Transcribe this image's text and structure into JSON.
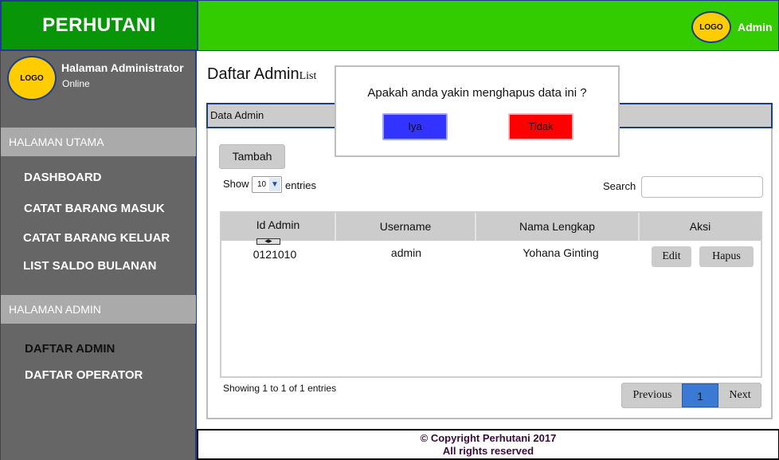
{
  "brand": {
    "title": "PERHUTANI"
  },
  "topbar": {
    "logo_text": "LOGO",
    "user": "Admin"
  },
  "sidebar": {
    "logo_text": "LOGO",
    "profile_name": "Halaman Administrator",
    "profile_status": "Online",
    "sections": [
      {
        "label": "HALAMAN UTAMA",
        "items": [
          "DASHBOARD",
          "CATAT BARANG MASUK",
          "CATAT BARANG KELUAR",
          "LIST SALDO BULANAN"
        ]
      },
      {
        "label": "HALAMAN ADMIN",
        "items": [
          "DAFTAR ADMIN",
          "DAFTAR OPERATOR"
        ]
      }
    ],
    "active_item": "DAFTAR ADMIN"
  },
  "main": {
    "title": "Daftar Admin",
    "subtitle": "List",
    "panel_title": "Data Admin",
    "add_button": "Tambah",
    "show_label": "Show",
    "page_size": "10",
    "entries_label": "entries",
    "search_label": "Search",
    "search_value": "",
    "columns": [
      "Id Admin",
      "Username",
      "Nama Lengkap",
      "Aksi"
    ],
    "rows": [
      {
        "id": "0121010",
        "username": "admin",
        "nama": "Yohana Ginting",
        "edit": "Edit",
        "delete": "Hapus"
      }
    ],
    "showing_text": "Showing 1 to 1 of 1 entries",
    "pagination": {
      "previous": "Previous",
      "current": "1",
      "next": "Next"
    }
  },
  "footer": {
    "line1": "© Copyright Perhutani 2017",
    "line2": "All rights reserved"
  },
  "modal": {
    "message": "Apakah anda yakin menghapus data ini ?",
    "confirm": "Iya",
    "cancel": "Tidak"
  },
  "colors": {
    "brand_green": "#089608",
    "topbar_green": "#33cc00",
    "sidebar_gray": "#666666",
    "section_gray": "#aaaaaa",
    "confirm_blue": "#3333ff",
    "cancel_red": "#ff0000",
    "page_active_blue": "#3b7ad4"
  }
}
